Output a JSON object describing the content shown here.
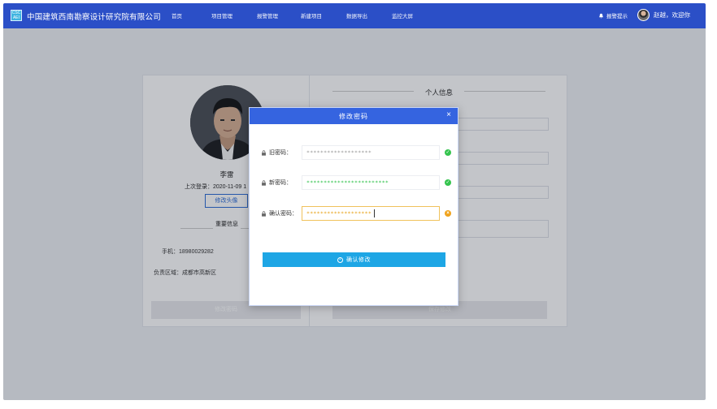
{
  "header": {
    "brand": "中国建筑西南勘察设计研究院有限公司",
    "logo_icon": "company-logo",
    "nav": [
      "首页",
      "项目管理",
      "报警管理",
      "新建项目",
      "数据导出",
      "监控大屏"
    ],
    "alarm_label": "报警提示",
    "greeting": "赵越，欢迎你",
    "bar_color": "#2b4fc7"
  },
  "profile": {
    "name": "李雷",
    "last_login": "上次登录：2020-11-09 1",
    "change_avatar": "修改头像",
    "section_title": "重要信息",
    "phone": "手机：18980029282",
    "region": "负责区域：成都市高新区",
    "change_password_button": "修改密码"
  },
  "personal_info": {
    "title": "个人信息",
    "save_button": "保存修改"
  },
  "modal": {
    "title": "修改密码",
    "close": "×",
    "header_color": "#3564e0",
    "old_label": "旧密码：",
    "old_value": "*******************",
    "new_label": "新密码：",
    "new_value": "************************",
    "confirm_label": "确认密码：",
    "confirm_value": "*******************",
    "submit": "确认修改",
    "status_ok_color": "#35c44e",
    "status_warn_color": "#f0a31c"
  }
}
